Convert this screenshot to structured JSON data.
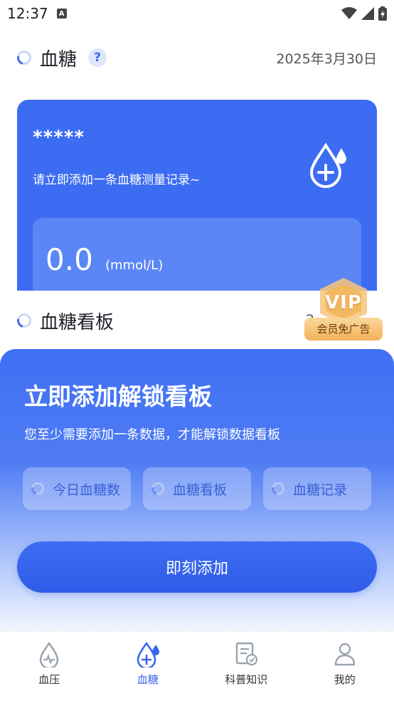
{
  "status_bar": {
    "time": "12:37",
    "notif_glyph": "A"
  },
  "header": {
    "title": "血糖",
    "help": "?",
    "date": "2025年3月30日"
  },
  "card": {
    "masked_name": "*****",
    "hint": "请立即添加一条血糖测量记录~",
    "value": "0.0",
    "unit": "(mmol/L)"
  },
  "section2": {
    "title": "血糖看板",
    "date_partial": "2"
  },
  "vip": {
    "badge": "VIP",
    "label": "会员免广告"
  },
  "overlay": {
    "title": "立即添加解锁看板",
    "desc": "您至少需要添加一条数据，才能解锁数据看板",
    "chips": [
      {
        "label": "今日血糖数"
      },
      {
        "label": "血糖看板"
      },
      {
        "label": "血糖记录"
      }
    ],
    "button": "即刻添加"
  },
  "tabbar": {
    "items": [
      {
        "label": "血压",
        "icon": "blood-pressure-icon"
      },
      {
        "label": "血糖",
        "icon": "blood-drop-plus-icon",
        "active": true
      },
      {
        "label": "科普知识",
        "icon": "document-check-icon"
      },
      {
        "label": "我的",
        "icon": "person-icon"
      }
    ],
    "active_color": "#3a66ef"
  },
  "colors": {
    "primary": "#3c6cf2",
    "vip_gold": "#f3b25c"
  }
}
